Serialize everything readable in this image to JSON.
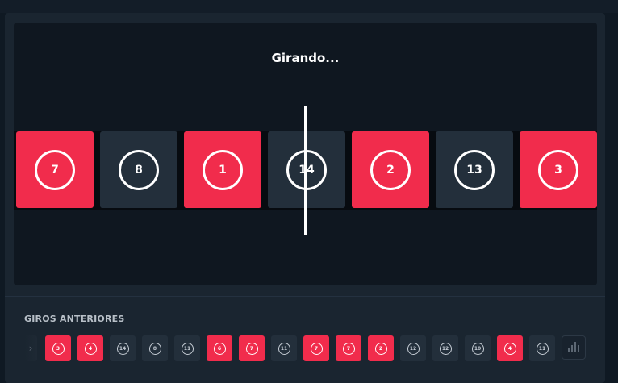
{
  "status": {
    "text": "Girando..."
  },
  "roulette": {
    "tiles": [
      {
        "number": "7",
        "color": "red"
      },
      {
        "number": "8",
        "color": "dark"
      },
      {
        "number": "1",
        "color": "red"
      },
      {
        "number": "14",
        "color": "dark"
      },
      {
        "number": "2",
        "color": "red"
      },
      {
        "number": "13",
        "color": "dark"
      },
      {
        "number": "3",
        "color": "red"
      }
    ]
  },
  "history": {
    "title": "GIROS ANTERIORES",
    "scroll_left_icon": "chevron-left-icon",
    "items": [
      {
        "number": "3",
        "color": "red"
      },
      {
        "number": "4",
        "color": "red"
      },
      {
        "number": "14",
        "color": "dark"
      },
      {
        "number": "8",
        "color": "dark"
      },
      {
        "number": "11",
        "color": "dark"
      },
      {
        "number": "6",
        "color": "red"
      },
      {
        "number": "7",
        "color": "red"
      },
      {
        "number": "11",
        "color": "dark"
      },
      {
        "number": "7",
        "color": "red"
      },
      {
        "number": "7",
        "color": "red"
      },
      {
        "number": "2",
        "color": "red"
      },
      {
        "number": "12",
        "color": "dark"
      },
      {
        "number": "12",
        "color": "dark"
      },
      {
        "number": "10",
        "color": "dark"
      },
      {
        "number": "4",
        "color": "red"
      },
      {
        "number": "11",
        "color": "dark"
      }
    ],
    "stats_icon": "bar-chart-icon"
  },
  "colors": {
    "red": "#f12c4c",
    "dark": "#232f3b",
    "background": "#0f1923"
  }
}
